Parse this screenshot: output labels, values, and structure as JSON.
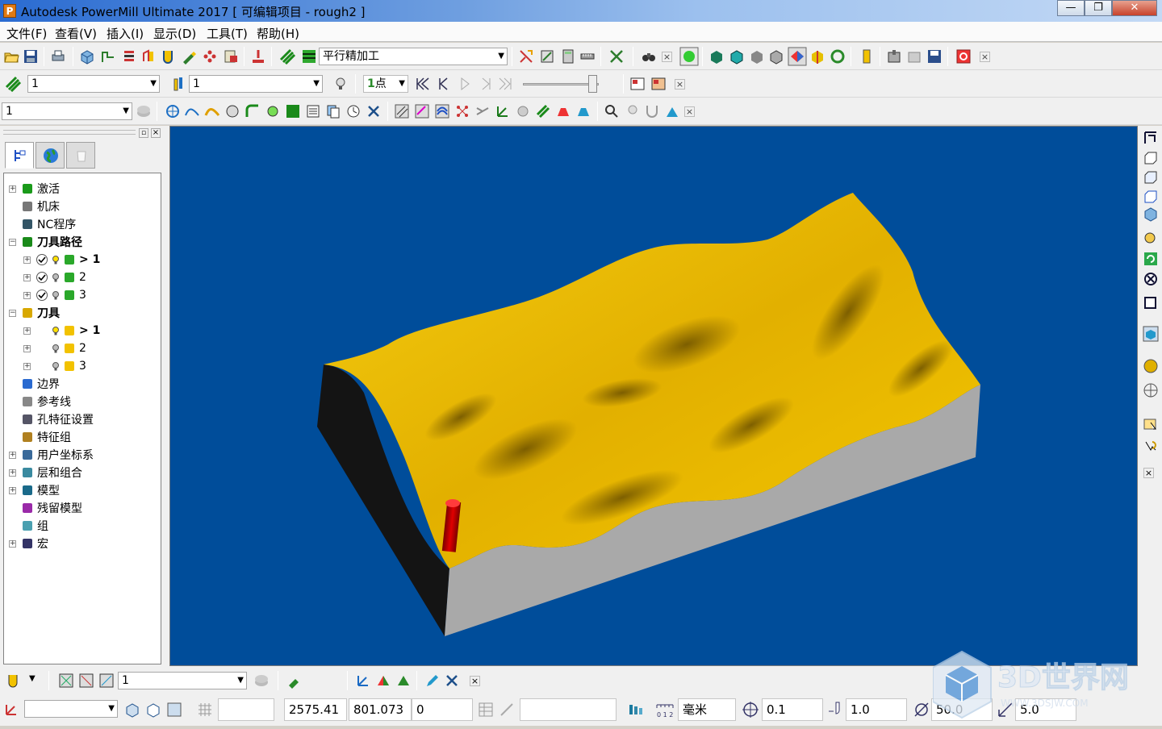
{
  "window": {
    "app_icon_letter": "P",
    "title": "Autodesk PowerMill Ultimate 2017   [ 可编辑项目 - rough2 ]",
    "min": "—",
    "max": "❐",
    "close": "✕"
  },
  "menu": [
    "文件(F)",
    "查看(V)",
    "插入(I)",
    "显示(D)",
    "工具(T)",
    "帮助(H)"
  ],
  "toolbar1": {
    "strategy_label": "平行精加工"
  },
  "toolbar2": {
    "toolpath_combo": "1",
    "tool_combo": "1",
    "points_label": "点",
    "points_prefix": "1"
  },
  "toolbar3": {
    "layer_combo": "1"
  },
  "tree": {
    "nodes": [
      {
        "label": "激活",
        "level": 0,
        "exp": "+",
        "icon": "activate-icon",
        "bold": false
      },
      {
        "label": "机床",
        "level": 0,
        "exp": "",
        "icon": "machine-icon",
        "bold": false
      },
      {
        "label": "NC程序",
        "level": 0,
        "exp": "",
        "icon": "nc-program-icon",
        "bold": false
      },
      {
        "label": "刀具路径",
        "level": 0,
        "exp": "−",
        "icon": "toolpath-icon",
        "bold": true
      },
      {
        "label": "> 1",
        "level": 1,
        "exp": "+",
        "icon": "toolpath-item-icon",
        "bold": true
      },
      {
        "label": "2",
        "level": 1,
        "exp": "+",
        "icon": "toolpath-item-icon",
        "bold": false
      },
      {
        "label": "3",
        "level": 1,
        "exp": "+",
        "icon": "toolpath-item-icon",
        "bold": false
      },
      {
        "label": "刀具",
        "level": 0,
        "exp": "−",
        "icon": "tools-icon",
        "bold": true
      },
      {
        "label": "> 1",
        "level": 1,
        "exp": "+",
        "icon": "tool-item-icon",
        "bold": true
      },
      {
        "label": "2",
        "level": 1,
        "exp": "+",
        "icon": "tool-item-icon",
        "bold": false
      },
      {
        "label": "3",
        "level": 1,
        "exp": "+",
        "icon": "tool-item-icon",
        "bold": false
      },
      {
        "label": "边界",
        "level": 0,
        "exp": "",
        "icon": "boundary-icon",
        "bold": false
      },
      {
        "label": "参考线",
        "level": 0,
        "exp": "",
        "icon": "pattern-icon",
        "bold": false
      },
      {
        "label": "孔特征设置",
        "level": 0,
        "exp": "",
        "icon": "hole-feature-icon",
        "bold": false
      },
      {
        "label": "特征组",
        "level": 0,
        "exp": "",
        "icon": "feature-group-icon",
        "bold": false
      },
      {
        "label": "用户坐标系",
        "level": 0,
        "exp": "+",
        "icon": "workplane-icon",
        "bold": false
      },
      {
        "label": "层和组合",
        "level": 0,
        "exp": "+",
        "icon": "layers-icon",
        "bold": false
      },
      {
        "label": "模型",
        "level": 0,
        "exp": "+",
        "icon": "model-icon",
        "bold": false
      },
      {
        "label": "残留模型",
        "level": 0,
        "exp": "",
        "icon": "stock-model-icon",
        "bold": false
      },
      {
        "label": "组",
        "level": 0,
        "exp": "",
        "icon": "group-icon",
        "bold": false
      },
      {
        "label": "宏",
        "level": 0,
        "exp": "+",
        "icon": "macro-icon",
        "bold": false
      }
    ]
  },
  "bottom_toolbar": {
    "tool_combo": "1"
  },
  "status": {
    "x": "2575.41",
    "y": "801.073",
    "z": "0",
    "units": "毫米",
    "tolerance": "0.1",
    "thickness": "1.0",
    "diameter": "50.0",
    "step": "5.0"
  },
  "watermark": {
    "text": "3D世界网",
    "url": "WWW.3DSJW.COM"
  },
  "colors": {
    "viewport_bg": "#004d9a",
    "surface": "#f2c200",
    "side": "#a8a8a8",
    "tool": "#d10000"
  }
}
